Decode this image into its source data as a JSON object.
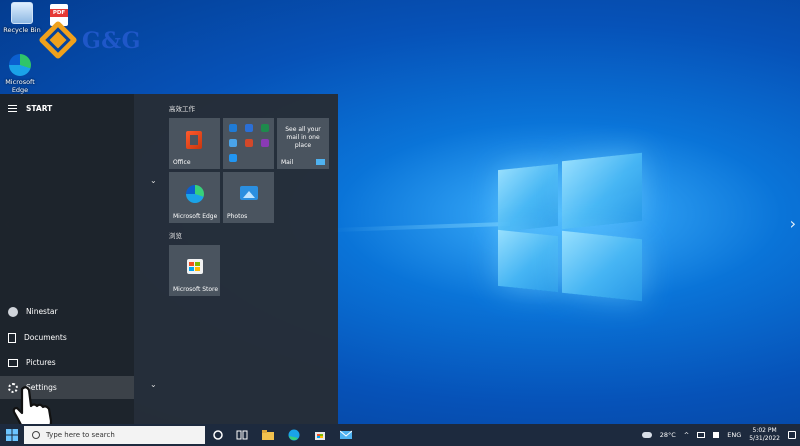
{
  "desktop": {
    "recycle_bin": "Recycle Bin",
    "edge_shortcut": "Microsoft Edge",
    "pdf_badge": "PDF",
    "brand_text": "G&G"
  },
  "start_menu": {
    "header": "START",
    "rail": {
      "user": "Ninestar",
      "documents": "Documents",
      "pictures": "Pictures",
      "settings": "Settings"
    },
    "groups": [
      "高效工作",
      "浏览"
    ],
    "tiles": {
      "office": "Office",
      "mail_text": "See all your mail in one place",
      "mail": "Mail",
      "edge": "Microsoft Edge",
      "photos": "Photos",
      "store": "Microsoft Store"
    },
    "chevron": "⌄"
  },
  "taskbar": {
    "search_placeholder": "Type here to search",
    "weather": "28°C",
    "language": "ENG",
    "time": "5:02 PM",
    "date": "5/31/2022"
  },
  "nav": {
    "left": "‹",
    "right": "›"
  },
  "colors": {
    "accent": "#0a74d8",
    "taskbar": "#1d2a3e",
    "start_bg": "#272d35"
  }
}
